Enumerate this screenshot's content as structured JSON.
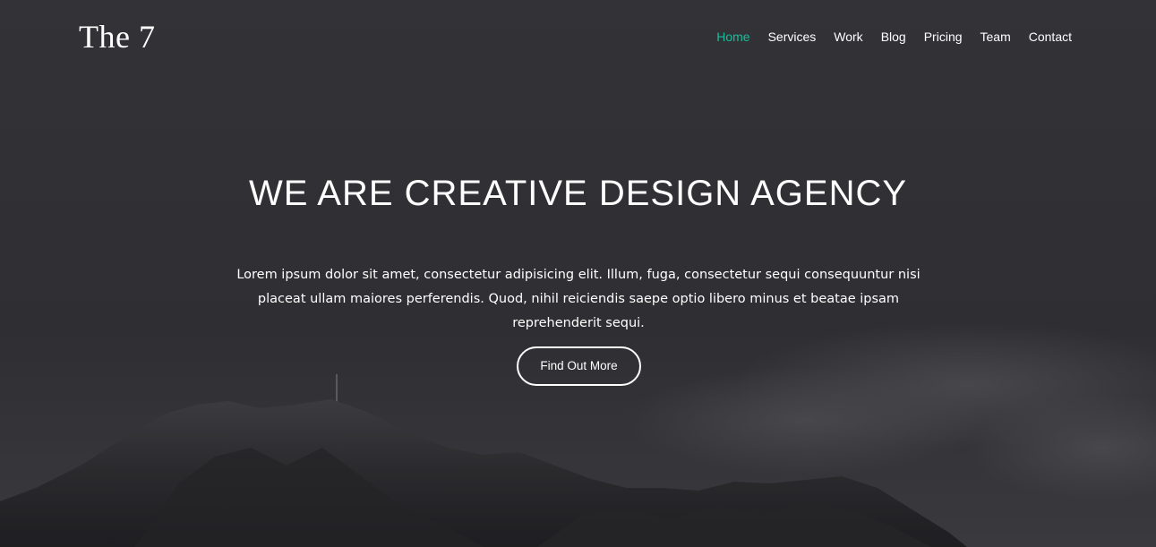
{
  "brand": {
    "logo_text": "The 7"
  },
  "nav": {
    "items": [
      {
        "label": "Home",
        "active": true
      },
      {
        "label": "Services",
        "active": false
      },
      {
        "label": "Work",
        "active": false
      },
      {
        "label": "Blog",
        "active": false
      },
      {
        "label": "Pricing",
        "active": false
      },
      {
        "label": "Team",
        "active": false
      },
      {
        "label": "Contact",
        "active": false
      }
    ],
    "active_color": "#1abc9c"
  },
  "hero": {
    "headline": "WE ARE CREATIVE DESIGN AGENCY",
    "lead": "Lorem ipsum dolor sit amet, consectetur adipisicing elit. Illum, fuga, consectetur sequi consequuntur nisi placeat ullam maiores perferendis. Quod, nihil reiciendis saepe optio libero minus et beatae ipsam reprehenderit sequi.",
    "cta_label": "Find Out More",
    "background": "dark mountain landscape"
  }
}
